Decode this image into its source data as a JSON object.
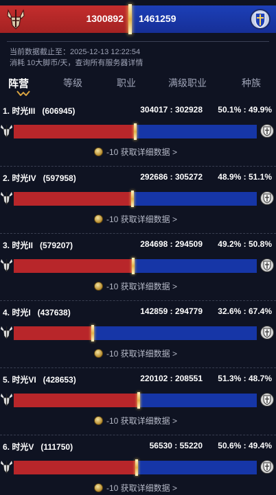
{
  "summary": {
    "horde_total": "1300892",
    "alliance_total": "1461259",
    "horde_share": 0.471,
    "horde_icon": "horde-crest-icon",
    "alliance_icon": "alliance-crest-icon",
    "colors": {
      "horde": "#b8262a",
      "alliance": "#1636a7",
      "divider": "#e2b24a"
    }
  },
  "info": {
    "line1": "当前数据截止至：2025-12-13 12:22:54",
    "line2": "消耗 10大脚币/天，查询所有服务器详情"
  },
  "tabs": [
    {
      "label": "阵营",
      "active": true
    },
    {
      "label": "等级",
      "active": false
    },
    {
      "label": "职业",
      "active": false
    },
    {
      "label": "满级职业",
      "active": false
    },
    {
      "label": "种族",
      "active": false
    }
  ],
  "servers": [
    {
      "title": "1. 时光III   (606945)",
      "score": "304017 : 302928",
      "pct": "50.1% : 49.9%",
      "horde_share": 0.501,
      "detail": "-10 获取详细数据 >"
    },
    {
      "title": "2. 时光IV   (597958)",
      "score": "292686 : 305272",
      "pct": "48.9% : 51.1%",
      "horde_share": 0.489,
      "detail": "-10 获取详细数据 >"
    },
    {
      "title": "3. 时光II   (579207)",
      "score": "284698 : 294509",
      "pct": "49.2% : 50.8%",
      "horde_share": 0.492,
      "detail": "-10 获取详细数据 >"
    },
    {
      "title": "4. 时光I   (437638)",
      "score": "142859 : 294779",
      "pct": "32.6% : 67.4%",
      "horde_share": 0.326,
      "detail": "-10 获取详细数据 >"
    },
    {
      "title": "5. 时光VI   (428653)",
      "score": "220102 : 208551",
      "pct": "51.3% : 48.7%",
      "horde_share": 0.513,
      "detail": "-10 获取详细数据 >"
    },
    {
      "title": "6. 时光V   (111750)",
      "score": "56530 : 55220",
      "pct": "50.6% : 49.4%",
      "horde_share": 0.506,
      "detail": "-10 获取详细数据 >"
    }
  ]
}
